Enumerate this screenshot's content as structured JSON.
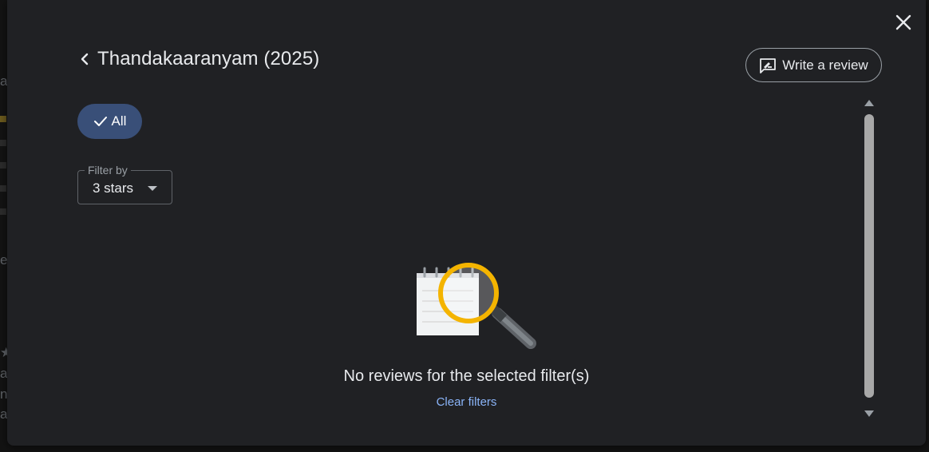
{
  "dialog": {
    "title": "Thandakaaranyam (2025)",
    "write_review_label": "Write a review"
  },
  "chip": {
    "label": "All",
    "selected": true
  },
  "filter": {
    "legend": "Filter by",
    "value": "3 stars"
  },
  "empty_state": {
    "message": "No reviews for the selected filter(s)",
    "clear_label": "Clear filters"
  },
  "icons": {
    "close": "close-icon",
    "back": "chevron-left-icon",
    "write": "rate-review-icon",
    "check": "check-icon",
    "dropdown": "arrow-drop-down-icon",
    "illustration": "notepad-magnifier-icon"
  },
  "colors": {
    "dialog_bg": "#202124",
    "chip_bg": "#394f78",
    "link": "#8ab4f8",
    "magnifier_ring": "#f4b400"
  }
}
